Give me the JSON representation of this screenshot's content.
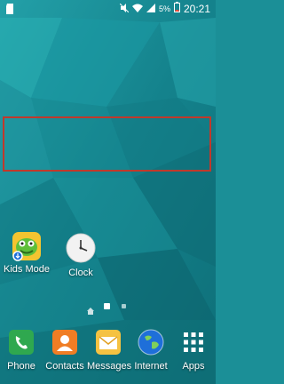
{
  "status_bar": {
    "battery": "5%",
    "time": "20:21",
    "icons": [
      "sd-card-icon",
      "mute-icon",
      "wifi-icon",
      "signal-icon",
      "battery-icon"
    ]
  },
  "home_apps": [
    {
      "label": "Kids Mode",
      "icon": "kids-mode-icon"
    },
    {
      "label": "Clock",
      "icon": "clock-icon"
    }
  ],
  "page_indicator": {
    "items": [
      "home-page",
      "page-1",
      "page-2"
    ],
    "active": 1
  },
  "dock": [
    {
      "label": "Phone",
      "icon": "phone-icon",
      "color": "#2fa84f"
    },
    {
      "label": "Contacts",
      "icon": "contacts-icon",
      "color": "#f07d24"
    },
    {
      "label": "Messages",
      "icon": "messages-icon",
      "color": "#f5c242"
    },
    {
      "label": "Internet",
      "icon": "internet-icon",
      "color": "#1e6fd9"
    },
    {
      "label": "Apps",
      "icon": "apps-icon",
      "color": "#ffffff"
    }
  ]
}
